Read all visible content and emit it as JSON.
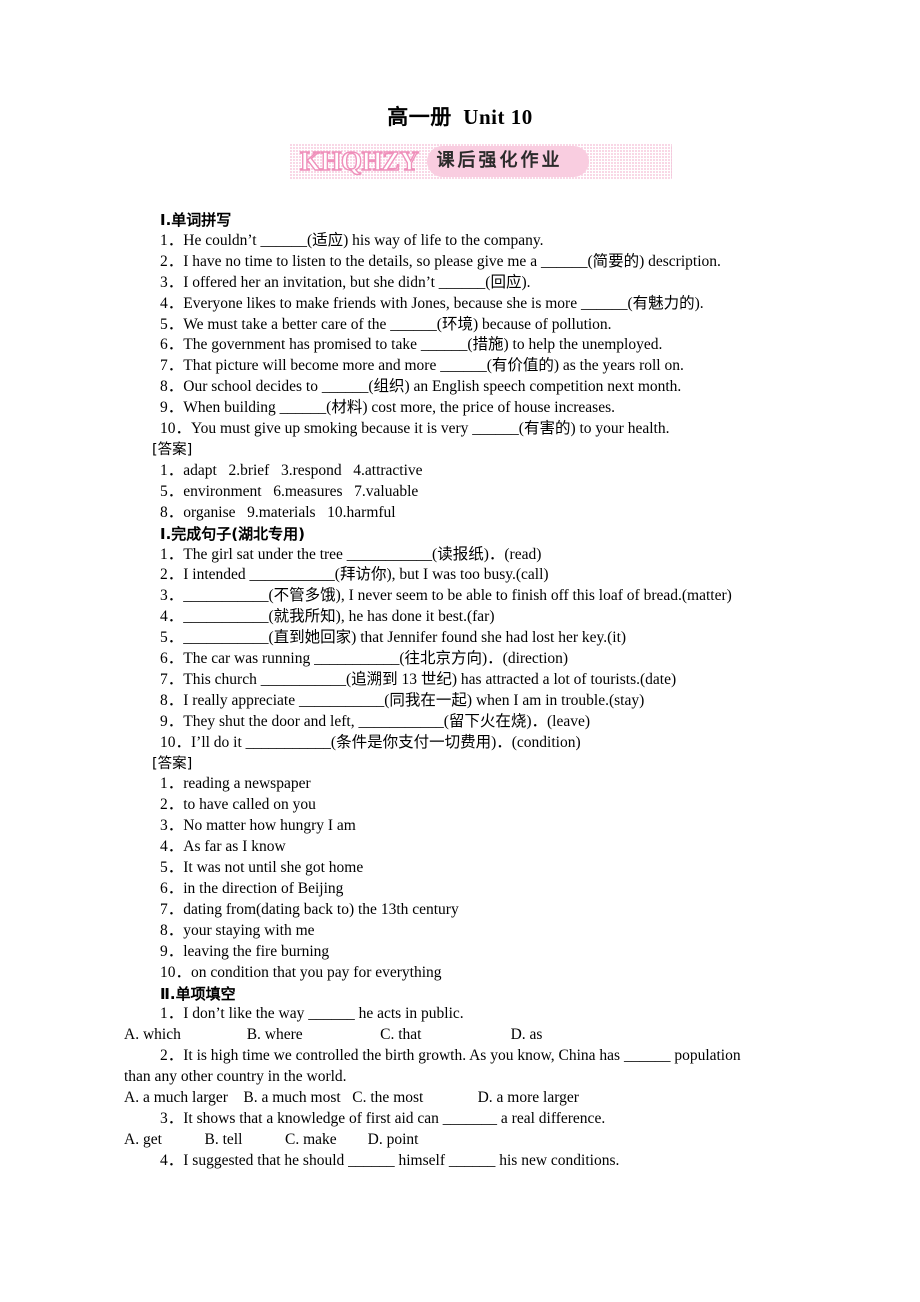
{
  "header": {
    "title": "高一册  Unit 10",
    "banner": {
      "mark": "KHQHZY",
      "label": "课后强化作业"
    }
  },
  "sections": [
    {
      "id": "section-1",
      "numeral": "Ⅰ",
      "heading": ".单词拼写",
      "heading_full": "Ⅰ.单词拼写",
      "items": [
        "1．He couldn’t ______(适应) his way of life to the company.",
        "2．I have no time to listen to the details, so please give me a ______(简要的) description.",
        "3．I offered her an invitation, but she didn’t ______(回应).",
        "4．Everyone likes to make friends with Jones, because she is more ______(有魅力的).",
        "5．We must take a better care of the ______(环境) because of pollution.",
        "6．The government has promised to take ______(措施) to help the unemployed.",
        "7．That picture will become more and more ______(有价值的) as the years roll on.",
        "8．Our school decides to ______(组织) an English speech competition next month.",
        "9．When building ______(材料) cost more, the price of house increases.",
        "10．You must give up smoking because it is very ______(有害的) to your health."
      ],
      "answer_label": "[答案]",
      "answers": [
        "1．adapt   2.brief   3.respond   4.attractive",
        "5．environment   6.measures   7.valuable",
        "8．organise   9.materials   10.harmful"
      ]
    },
    {
      "id": "section-2",
      "numeral": "Ⅰ",
      "heading": ".完成句子(湖北专用)",
      "heading_full": "Ⅰ.完成句子(湖北专用)",
      "items": [
        "1．The girl sat under the tree ___________(读报纸)．(read)",
        "2．I intended ___________(拜访你), but I was too busy.(call)",
        "3．___________(不管多饿), I never seem to be able to finish off this loaf of bread.(matter)",
        "4．___________(就我所知), he has done it best.(far)",
        "5．___________(直到她回家) that Jennifer found she had lost her key.(it)",
        "6．The car was running ___________(往北京方向)．(direction)",
        "7．This church ___________(追溯到 13 世纪) has attracted a lot of tourists.(date)",
        "8．I really appreciate ___________(同我在一起) when I am in trouble.(stay)",
        "9．They shut the door and left, ___________(留下火在烧)．(leave)",
        "10．I’ll do it ___________(条件是你支付一切费用)．(condition)"
      ],
      "answer_label": "[答案]",
      "answers": [
        "1．reading a newspaper",
        "2．to have called on you",
        "3．No matter how hungry I am",
        "4．As far as I know",
        "5．It was not until she got home",
        "6．in the direction of Beijing",
        "7．dating from(dating back to) the 13th century",
        "8．your staying with me",
        "9．leaving the fire burning",
        "10．on condition that you pay for everything"
      ]
    },
    {
      "id": "section-3",
      "numeral": "Ⅱ",
      "heading": ".单项填空",
      "heading_full": "Ⅱ.单项填空",
      "questions": [
        {
          "stem": "1．I don’t like the way ______ he acts in public.",
          "stem_wrap": "",
          "choices": "A. which                 B. where                    C. that                       D. as"
        },
        {
          "stem": "2．It is high time we controlled the birth growth. As you know, China has ______ population",
          "stem_wrap": "than any other country in the world.",
          "choices": "A. a much larger    B. a much most   C. the most              D. a more larger"
        },
        {
          "stem": "3．It shows that a knowledge of first aid can _______ a real difference.",
          "stem_wrap": "",
          "choices": "A. get           B. tell           C. make        D. point"
        },
        {
          "stem": "4．I suggested that he should ______ himself ______ his new conditions.",
          "stem_wrap": "",
          "choices": ""
        }
      ]
    }
  ]
}
